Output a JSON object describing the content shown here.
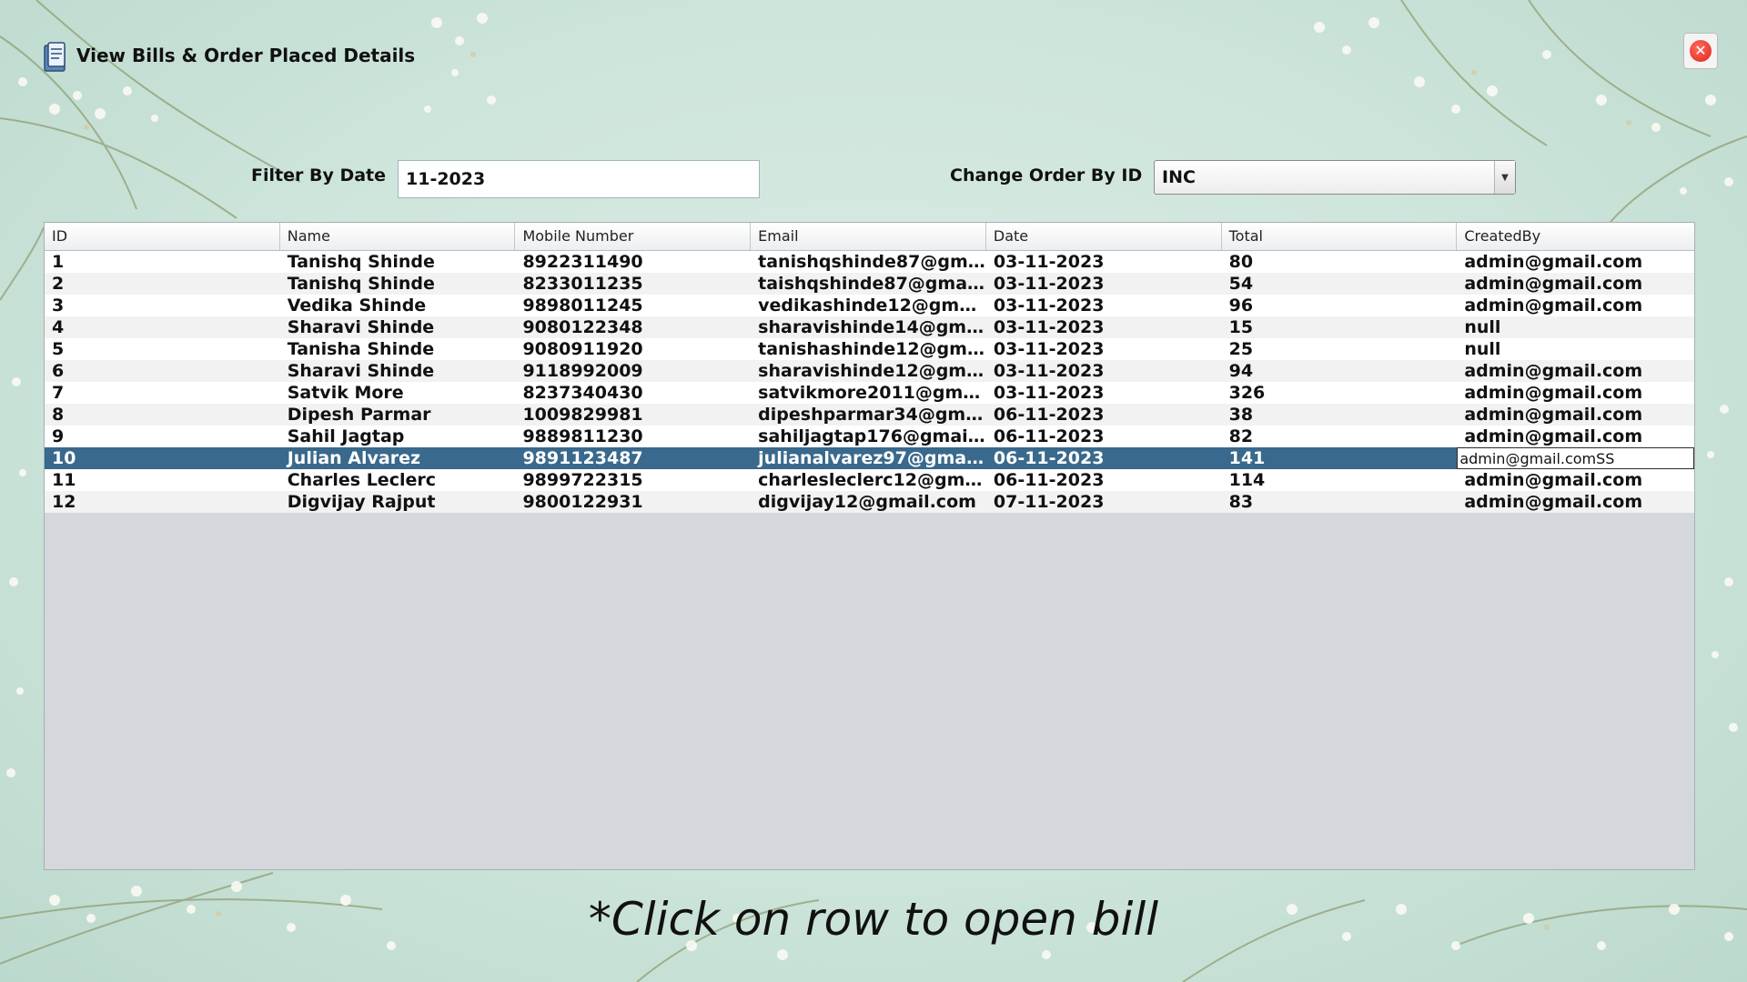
{
  "window": {
    "title": "View Bills & Order Placed Details"
  },
  "filter": {
    "label": "Filter By Date",
    "value": "11-2023"
  },
  "order": {
    "label": "Change Order By ID",
    "selected": "INC"
  },
  "table": {
    "columns": [
      "ID",
      "Name",
      "Mobile Number",
      "Email",
      "Date",
      "Total",
      "CreatedBy"
    ],
    "rows": [
      [
        "1",
        "Tanishq Shinde",
        "8922311490",
        "tanishqshinde87@gma...",
        "03-11-2023",
        "80",
        "admin@gmail.com"
      ],
      [
        "2",
        "Tanishq Shinde",
        "8233011235",
        "taishqshinde87@gmail...",
        "03-11-2023",
        "54",
        "admin@gmail.com"
      ],
      [
        "3",
        "Vedika Shinde",
        "9898011245",
        "vedikashinde12@gmai...",
        "03-11-2023",
        "96",
        "admin@gmail.com"
      ],
      [
        "4",
        "Sharavi Shinde",
        "9080122348",
        "sharavishinde14@gmai...",
        "03-11-2023",
        "15",
        "null"
      ],
      [
        "5",
        "Tanisha Shinde",
        "9080911920",
        "tanishashinde12@gma...",
        "03-11-2023",
        "25",
        "null"
      ],
      [
        "6",
        "Sharavi Shinde",
        "9118992009",
        "sharavishinde12@gmai...",
        "03-11-2023",
        "94",
        "admin@gmail.com"
      ],
      [
        "7",
        "Satvik More",
        "8237340430",
        "satvikmore2011@gmai...",
        "03-11-2023",
        "326",
        "admin@gmail.com"
      ],
      [
        "8",
        "Dipesh Parmar",
        "1009829981",
        "dipeshparmar34@gma...",
        "06-11-2023",
        "38",
        "admin@gmail.com"
      ],
      [
        "9",
        "Sahil Jagtap",
        "9889811230",
        "sahiljagtap176@gmail....",
        "06-11-2023",
        "82",
        "admin@gmail.com"
      ],
      [
        "10",
        "Julian Alvarez",
        "9891123487",
        "julianalvarez97@gmail....",
        "06-11-2023",
        "141",
        "admin@gmail.comSS"
      ],
      [
        "11",
        "Charles Leclerc",
        "9899722315",
        "charlesleclerc12@gmai...",
        "06-11-2023",
        "114",
        "admin@gmail.com"
      ],
      [
        "12",
        "Digvijay Rajput",
        "9800122931",
        "digvijay12@gmail.com",
        "07-11-2023",
        "83",
        "admin@gmail.com"
      ]
    ],
    "selected_row_index": 9
  },
  "hint": "*Click on row to open bill",
  "icons": {
    "title_icon": "bill-document-icon",
    "close_icon": "close-icon"
  },
  "colors": {
    "selected_row": "#39698c",
    "close_button": "#e02618"
  }
}
